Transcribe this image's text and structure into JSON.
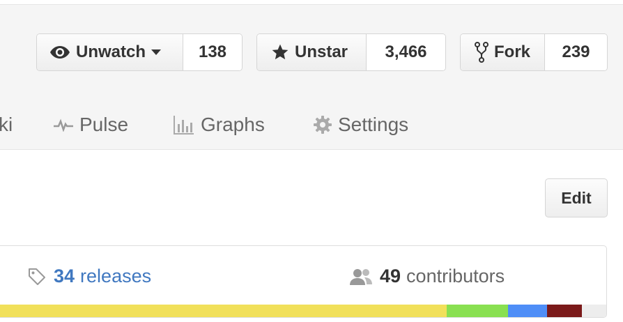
{
  "actions": {
    "watch": {
      "label": "Unwatch",
      "count": "138"
    },
    "star": {
      "label": "Unstar",
      "count": "3,466"
    },
    "fork": {
      "label": "Fork",
      "count": "239"
    }
  },
  "nav": {
    "wiki_partial": "ki",
    "pulse": "Pulse",
    "graphs": "Graphs",
    "settings": "Settings"
  },
  "edit_label": "Edit",
  "summary": {
    "releases_count": "34",
    "releases_text": "releases",
    "contributors_count": "49",
    "contributors_text": "contributors"
  },
  "language_colors": [
    "#f1e05a",
    "#89e051",
    "#4f8ef7",
    "#7b1a1a",
    "#ededed"
  ],
  "language_shares": [
    0.738,
    0.101,
    0.064,
    0.057,
    0.04
  ],
  "colors": {
    "link": "#4078c0",
    "text": "#333333",
    "muted": "#666666"
  }
}
